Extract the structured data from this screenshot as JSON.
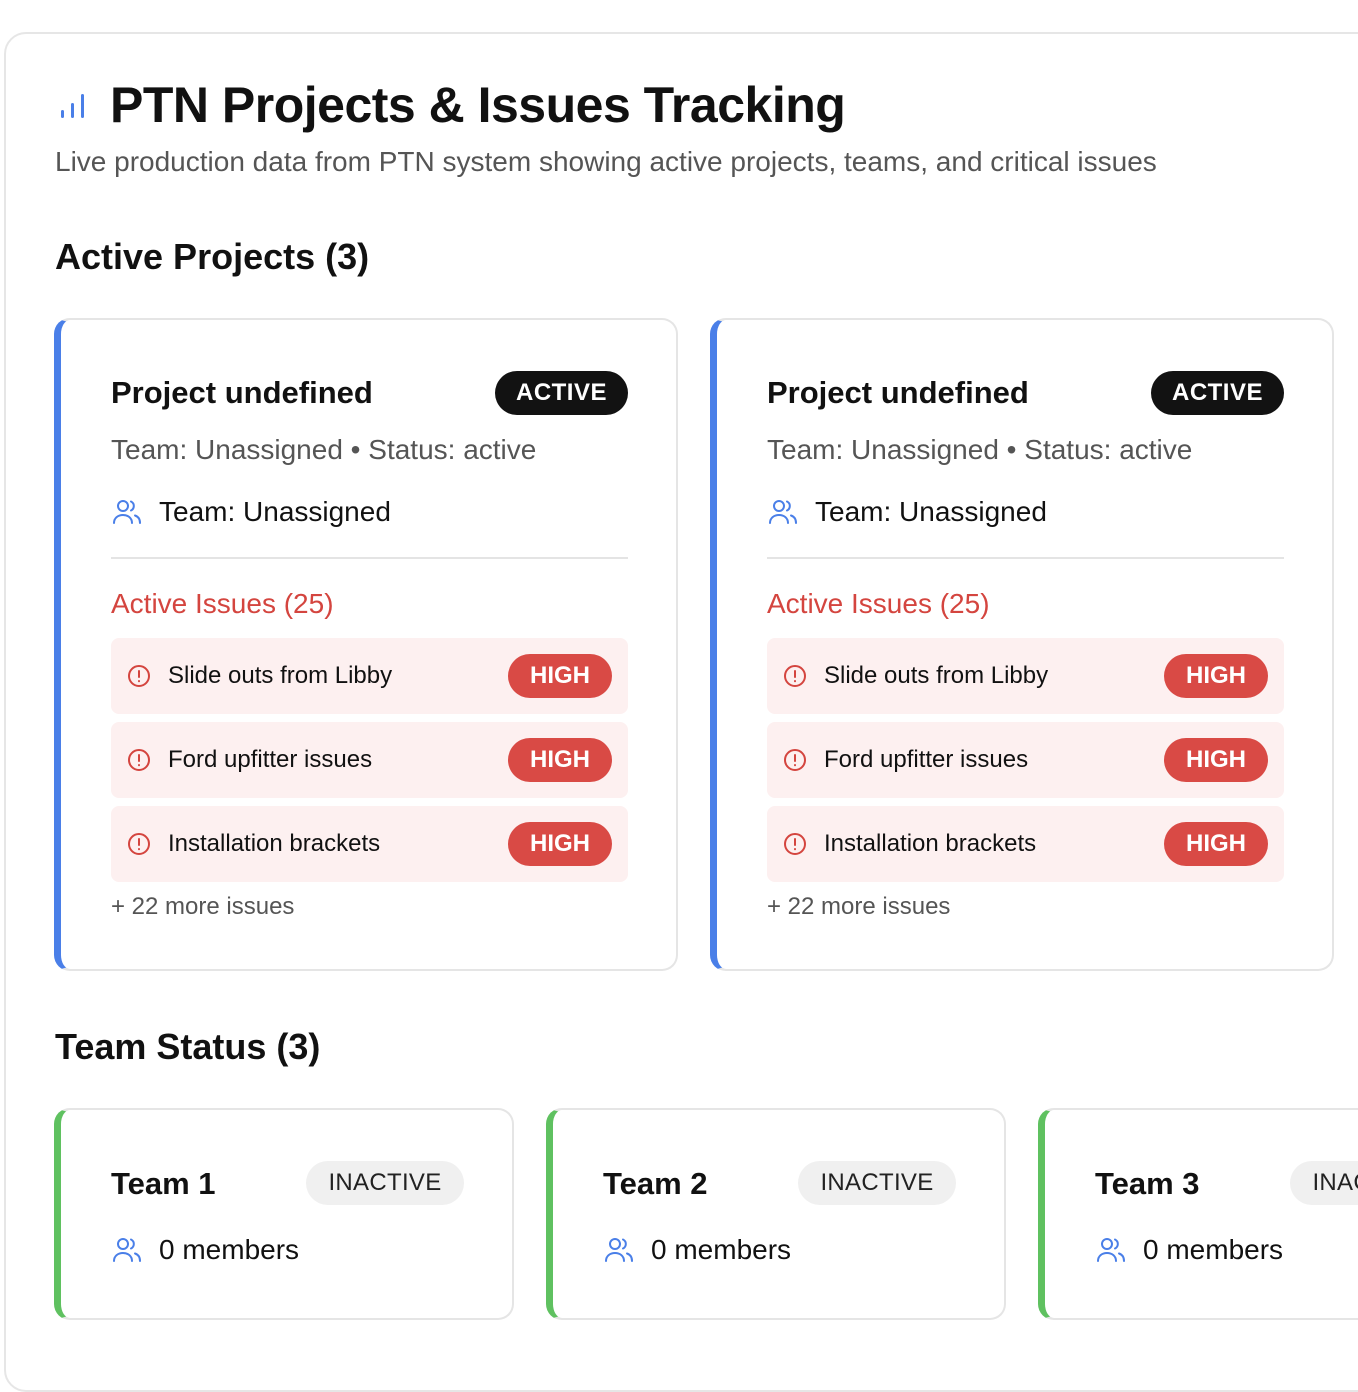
{
  "header": {
    "title": "PTN Projects & Issues Tracking",
    "subtitle": "Live production data from PTN system showing active projects, teams, and critical issues",
    "icon": "bar-chart-icon",
    "accent_color": "#4a7fe8"
  },
  "projects_section": {
    "heading": "Active Projects (3)",
    "projects": [
      {
        "title": "Project undefined",
        "status_badge": "ACTIVE",
        "meta": "Team: Unassigned • Status: active",
        "team": "Team: Unassigned",
        "issues_heading": "Active Issues (25)",
        "issues": [
          {
            "label": "Slide outs from Libby",
            "priority": "HIGH"
          },
          {
            "label": "Ford upfitter issues",
            "priority": "HIGH"
          },
          {
            "label": "Installation brackets",
            "priority": "HIGH"
          }
        ],
        "more": "+ 22 more issues"
      },
      {
        "title": "Project undefined",
        "status_badge": "ACTIVE",
        "meta": "Team: Unassigned • Status: active",
        "team": "Team: Unassigned",
        "issues_heading": "Active Issues (25)",
        "issues": [
          {
            "label": "Slide outs from Libby",
            "priority": "HIGH"
          },
          {
            "label": "Ford upfitter issues",
            "priority": "HIGH"
          },
          {
            "label": "Installation brackets",
            "priority": "HIGH"
          }
        ],
        "more": "+ 22 more issues"
      }
    ]
  },
  "teams_section": {
    "heading": "Team Status (3)",
    "teams": [
      {
        "name": "Team 1",
        "status": "INACTIVE",
        "members": "0 members"
      },
      {
        "name": "Team 2",
        "status": "INACTIVE",
        "members": "0 members"
      },
      {
        "name": "Team 3",
        "status": "INACTIVE",
        "members": "0 members"
      }
    ]
  },
  "colors": {
    "project_accent": "#4a7fe8",
    "team_accent": "#5fc160",
    "issue_red": "#d94a45",
    "issue_bg": "#fdf0f0"
  }
}
